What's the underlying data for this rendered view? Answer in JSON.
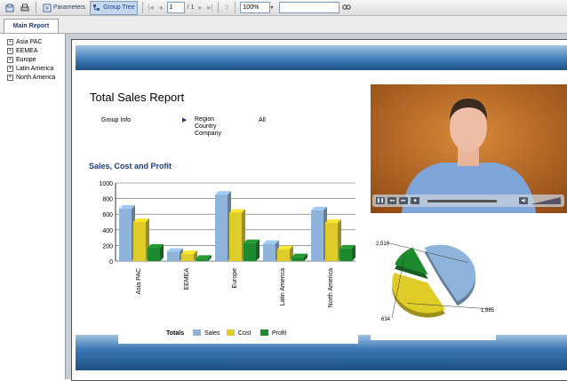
{
  "toolbar": {
    "parameters_label": "Parameters",
    "group_tree_label": "Group Tree",
    "page_current": "1",
    "page_total": "/ 1",
    "zoom": "100%",
    "search_value": ""
  },
  "tabs": [
    {
      "label": "Main Report"
    }
  ],
  "tree": {
    "items": [
      {
        "label": "Asia PAC"
      },
      {
        "label": "EEMEA"
      },
      {
        "label": "Europe"
      },
      {
        "label": "Latin America"
      },
      {
        "label": "North America"
      }
    ]
  },
  "report": {
    "title": "Total Sales Report",
    "group_info_label": "Group Info",
    "group_fields": [
      "Region",
      "Country",
      "Company"
    ],
    "group_value": "All",
    "chart_title": "Sales, Cost and Profit"
  },
  "colors": {
    "sales": "#8fb4dc",
    "cost": "#e0cc28",
    "profit": "#1e8a2e",
    "accent": "#1d3c7a"
  },
  "chart_data": [
    {
      "type": "bar",
      "categories": [
        "Asia PAC",
        "EEMEA",
        "Europe",
        "Latin America",
        "North America"
      ],
      "series": [
        {
          "name": "Sales",
          "values": [
            670,
            120,
            850,
            220,
            650
          ]
        },
        {
          "name": "Cost",
          "values": [
            500,
            90,
            620,
            150,
            490
          ]
        },
        {
          "name": "Profit",
          "values": [
            170,
            30,
            230,
            50,
            160
          ]
        }
      ],
      "ylim": [
        0,
        1000
      ],
      "yticks": [
        0,
        200,
        400,
        600,
        800,
        1000
      ],
      "legend_title": "Totals",
      "grid": true,
      "legend_position": "bottom"
    },
    {
      "type": "pie",
      "labels": [
        "2,510",
        "1,985",
        "634"
      ],
      "values": [
        2510,
        1985,
        634
      ]
    }
  ]
}
